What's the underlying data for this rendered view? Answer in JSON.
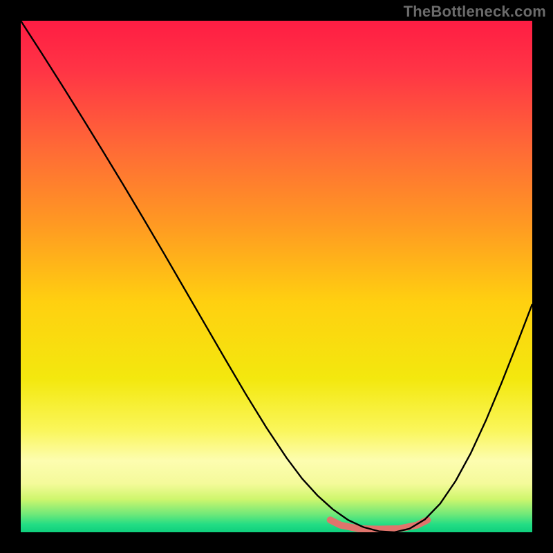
{
  "watermark": "TheBottleneck.com",
  "chart_data": {
    "type": "line",
    "title": "",
    "xlabel": "",
    "ylabel": "",
    "xlim": [
      0,
      100
    ],
    "ylim": [
      0,
      100
    ],
    "grid": false,
    "legend": false,
    "background_gradient_stops": [
      {
        "offset": 0.0,
        "color": "#ff1d44"
      },
      {
        "offset": 0.1,
        "color": "#ff3545"
      },
      {
        "offset": 0.25,
        "color": "#ff6a36"
      },
      {
        "offset": 0.4,
        "color": "#ff9a22"
      },
      {
        "offset": 0.55,
        "color": "#ffd010"
      },
      {
        "offset": 0.7,
        "color": "#f3e80e"
      },
      {
        "offset": 0.8,
        "color": "#faf65a"
      },
      {
        "offset": 0.86,
        "color": "#fdfdb0"
      },
      {
        "offset": 0.905,
        "color": "#f4fa9a"
      },
      {
        "offset": 0.935,
        "color": "#cff66d"
      },
      {
        "offset": 0.965,
        "color": "#6fe879"
      },
      {
        "offset": 0.985,
        "color": "#22dd84"
      },
      {
        "offset": 1.0,
        "color": "#0fcf7d"
      }
    ],
    "series": [
      {
        "name": "bottleneck-curve",
        "color": "#000000",
        "stroke_width": 2.4,
        "x": [
          0,
          4,
          8,
          12,
          16,
          20,
          24,
          28,
          32,
          36,
          40,
          44,
          48,
          52,
          55,
          58,
          61,
          64,
          67,
          70,
          73,
          76,
          79,
          82,
          85,
          88,
          91,
          94,
          97,
          100
        ],
        "y": [
          100,
          93.8,
          87.5,
          81.1,
          74.6,
          68.0,
          61.3,
          54.5,
          47.6,
          40.7,
          33.8,
          27.0,
          20.5,
          14.5,
          10.5,
          7.2,
          4.5,
          2.4,
          1.0,
          0.2,
          0.0,
          0.7,
          2.5,
          5.6,
          10.0,
          15.5,
          22.0,
          29.2,
          36.8,
          44.6
        ]
      },
      {
        "name": "optimal-zone",
        "color": "#e0746c",
        "stroke_width": 10,
        "linecap": "round",
        "x": [
          60.5,
          62.5,
          66,
          70,
          74,
          77.5,
          79.5
        ],
        "y": [
          2.4,
          1.4,
          0.7,
          0.6,
          0.7,
          1.4,
          2.4
        ]
      }
    ]
  }
}
